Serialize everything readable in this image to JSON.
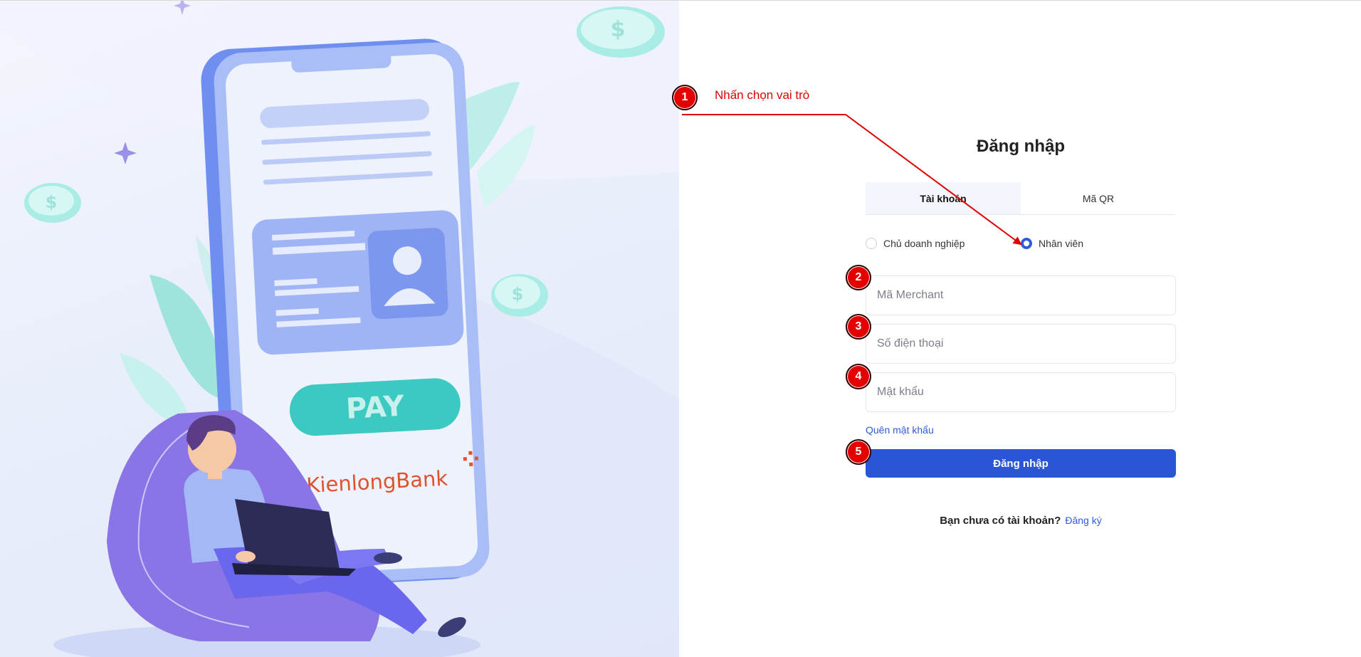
{
  "hero": {
    "brand_logo_text": "KienlongBank",
    "pay_button_label": "PAY",
    "coin_symbol": "$",
    "colors": {
      "phone": "#6f8ff0",
      "pay": "#3cc9c2",
      "brand_red": "#e0522d",
      "brand_blue": "#2e6fd8"
    }
  },
  "login": {
    "title": "Đăng nhập",
    "tabs": [
      {
        "label": "Tài khoản",
        "active": true
      },
      {
        "label": "Mã QR",
        "active": false
      }
    ],
    "roles": [
      {
        "label": "Chủ doanh nghiệp",
        "checked": false
      },
      {
        "label": "Nhân viên",
        "checked": true
      }
    ],
    "fields": {
      "merchant": {
        "placeholder": "Mã Merchant",
        "value": ""
      },
      "phone": {
        "placeholder": "Số điện thoại",
        "value": ""
      },
      "password": {
        "placeholder": "Mật khẩu",
        "value": ""
      }
    },
    "forgot_password": "Quên mật khẩu",
    "submit_label": "Đăng nhập",
    "no_account_text": "Bạn chưa có tài khoản?",
    "signup_link": "Đăng ký",
    "colors": {
      "primary": "#2a56d6",
      "link": "#2f5bd9"
    }
  },
  "annotations": {
    "step1_text": "Nhấn chọn vai trò",
    "badges": [
      "1",
      "2",
      "3",
      "4",
      "5"
    ],
    "color": "#e50000"
  }
}
